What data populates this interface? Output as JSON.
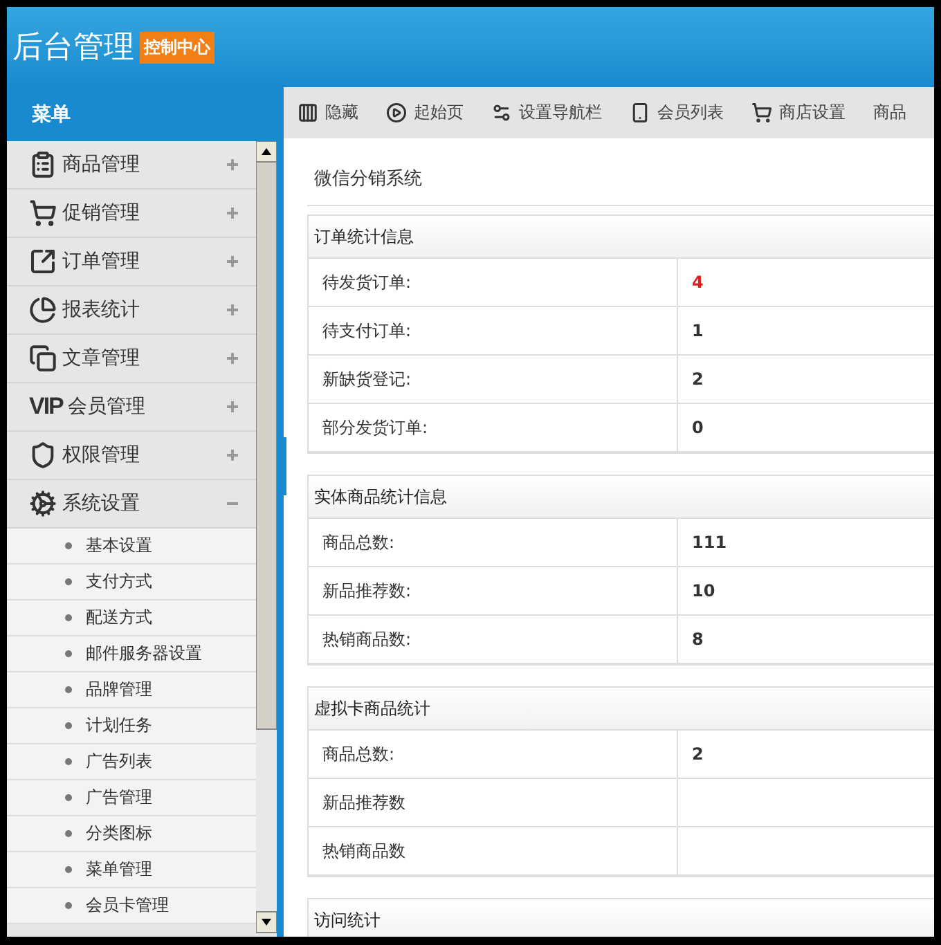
{
  "header": {
    "title": "后台管理",
    "badge": "控制中心"
  },
  "sidebar": {
    "heading": "菜单",
    "items": [
      {
        "kind": "goods",
        "label": "商品管理",
        "expanded": false
      },
      {
        "kind": "cart",
        "label": "促销管理",
        "expanded": false
      },
      {
        "kind": "order",
        "label": "订单管理",
        "expanded": false
      },
      {
        "kind": "report",
        "label": "报表统计",
        "expanded": false
      },
      {
        "kind": "article",
        "label": "文章管理",
        "expanded": false
      },
      {
        "kind": "vip",
        "icon_text": "VIP",
        "label": "会员管理",
        "expanded": false
      },
      {
        "kind": "shield",
        "label": "权限管理",
        "expanded": false
      },
      {
        "kind": "gears",
        "label": "系统设置",
        "expanded": true,
        "children": [
          {
            "label": "基本设置"
          },
          {
            "label": "支付方式"
          },
          {
            "label": "配送方式"
          },
          {
            "label": "邮件服务器设置"
          },
          {
            "label": "品牌管理"
          },
          {
            "label": "计划任务"
          },
          {
            "label": "广告列表"
          },
          {
            "label": "广告管理"
          },
          {
            "label": "分类图标"
          },
          {
            "label": "菜单管理"
          },
          {
            "label": "会员卡管理"
          }
        ]
      }
    ]
  },
  "toolbar": [
    {
      "kind": "hide",
      "label": "隐藏"
    },
    {
      "kind": "start",
      "label": "起始页"
    },
    {
      "kind": "nav",
      "label": "设置导航栏"
    },
    {
      "kind": "members",
      "label": "会员列表"
    },
    {
      "kind": "shop",
      "label": "商店设置"
    },
    {
      "kind": "plain",
      "label": "商品"
    }
  ],
  "content": {
    "title": "微信分销系统",
    "sections": [
      {
        "title": "订单统计信息",
        "rows": [
          {
            "label": "待发货订单:",
            "value": "4",
            "alert": true
          },
          {
            "label": "待支付订单:",
            "value": "1",
            "alert": false
          },
          {
            "label": "新缺货登记:",
            "value": "2",
            "alert": false
          },
          {
            "label": "部分发货订单:",
            "value": "0",
            "alert": false
          }
        ]
      },
      {
        "title": "实体商品统计信息",
        "rows": [
          {
            "label": "商品总数:",
            "value": "111",
            "alert": false
          },
          {
            "label": "新品推荐数:",
            "value": "10",
            "alert": false
          },
          {
            "label": "热销商品数:",
            "value": "8",
            "alert": false
          }
        ]
      },
      {
        "title": "虚拟卡商品统计",
        "rows": [
          {
            "label": "商品总数:",
            "value": "2",
            "alert": false
          },
          {
            "label": "新品推荐数"
          },
          {
            "label": "热销商品数"
          }
        ]
      },
      {
        "title": "访问统计"
      }
    ]
  }
}
